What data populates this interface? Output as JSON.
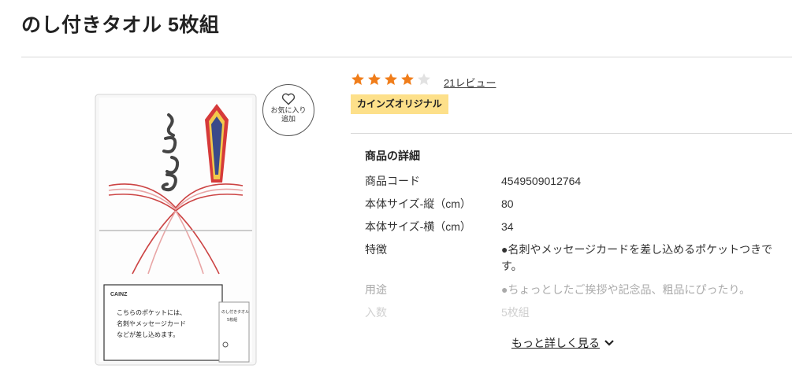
{
  "product": {
    "title": "のし付きタオル 5枚組"
  },
  "image": {
    "brand": "CAINZ",
    "noshi_text": "御年賀",
    "pocket_text": "こちらのポケットには、名刺やメッセージカードなどが差し込めます。",
    "tag_text": "のし付きタオル 5枚組",
    "favorite_label_line1": "お気に入り",
    "favorite_label_line2": "追加"
  },
  "rating": {
    "stars_filled": 4,
    "stars_total": 5,
    "review_label": "21レビュー"
  },
  "badge": {
    "label": "カインズオリジナル"
  },
  "details": {
    "heading": "商品の詳細",
    "rows": [
      {
        "label": "商品コード",
        "value": "4549509012764"
      },
      {
        "label": "本体サイズ-縦（cm）",
        "value": "80"
      },
      {
        "label": "本体サイズ-横（cm）",
        "value": "34"
      },
      {
        "label": "特徴",
        "value": "●名刺やメッセージカードを差し込めるポケットつきです。"
      },
      {
        "label": "用途",
        "value": "●ちょっとしたご挨拶や記念品、粗品にぴったり。"
      },
      {
        "label": "入数",
        "value": "5枚組"
      }
    ],
    "more_label": "もっと詳しく見る"
  },
  "colors": {
    "star_filled": "#f07d1a",
    "star_empty": "#e2e2e2",
    "badge_bg": "#fde08a",
    "divider": "#d8d8d8"
  }
}
